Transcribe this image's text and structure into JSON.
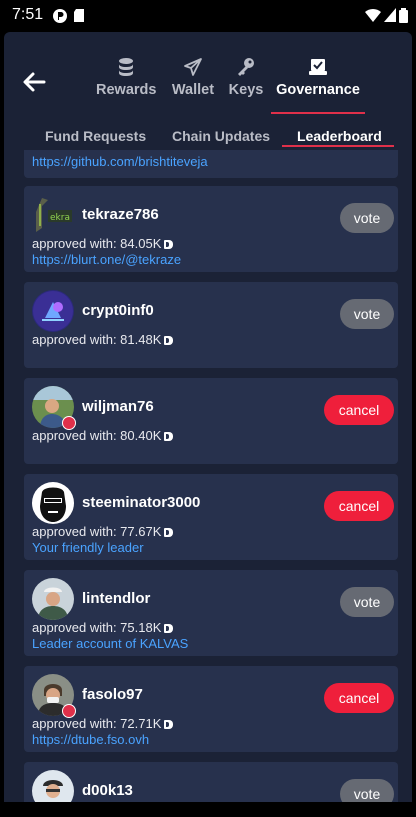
{
  "status_bar": {
    "time": "7:51"
  },
  "nav": {
    "back_icon": "arrow-left-icon",
    "tabs": [
      {
        "label": "Rewards",
        "icon": "coins-icon"
      },
      {
        "label": "Wallet",
        "icon": "send-icon"
      },
      {
        "label": "Keys",
        "icon": "key-icon"
      },
      {
        "label": "Governance",
        "icon": "ballot-icon",
        "active": true
      }
    ]
  },
  "subtabs": [
    {
      "label": "Fund Requests"
    },
    {
      "label": "Chain Updates"
    },
    {
      "label": "Leaderboard",
      "active": true
    }
  ],
  "partial_card": {
    "link": "https://github.com/brishtiteveja"
  },
  "witnesses": [
    {
      "name": "tekraze786",
      "approved": "approved with: 84.05K",
      "link": "https://blurt.one/@tekraze",
      "action": "vote"
    },
    {
      "name": "crypt0inf0",
      "approved": "approved with: 81.48K",
      "link": "",
      "action": "vote"
    },
    {
      "name": "wiljman76",
      "approved": "approved with: 80.40K",
      "link": "",
      "action": "cancel"
    },
    {
      "name": "steeminator3000",
      "approved": "approved with: 77.67K",
      "link": "Your  friendly leader",
      "action": "cancel"
    },
    {
      "name": "lintendlor",
      "approved": "approved with: 75.18K",
      "link": "Leader account of KALVAS",
      "action": "vote"
    },
    {
      "name": "fasolo97",
      "approved": "approved with: 72.71K",
      "link": "https://dtube.fso.ovh",
      "action": "cancel"
    },
    {
      "name": "d00k13",
      "approved": "",
      "link": "",
      "action": "vote"
    }
  ],
  "colors": {
    "accent": "#e0304a",
    "cancel": "#ef1f3b",
    "vote": "#666a73",
    "link": "#4aa3ff",
    "card": "#27314d",
    "background": "#1b2236"
  }
}
